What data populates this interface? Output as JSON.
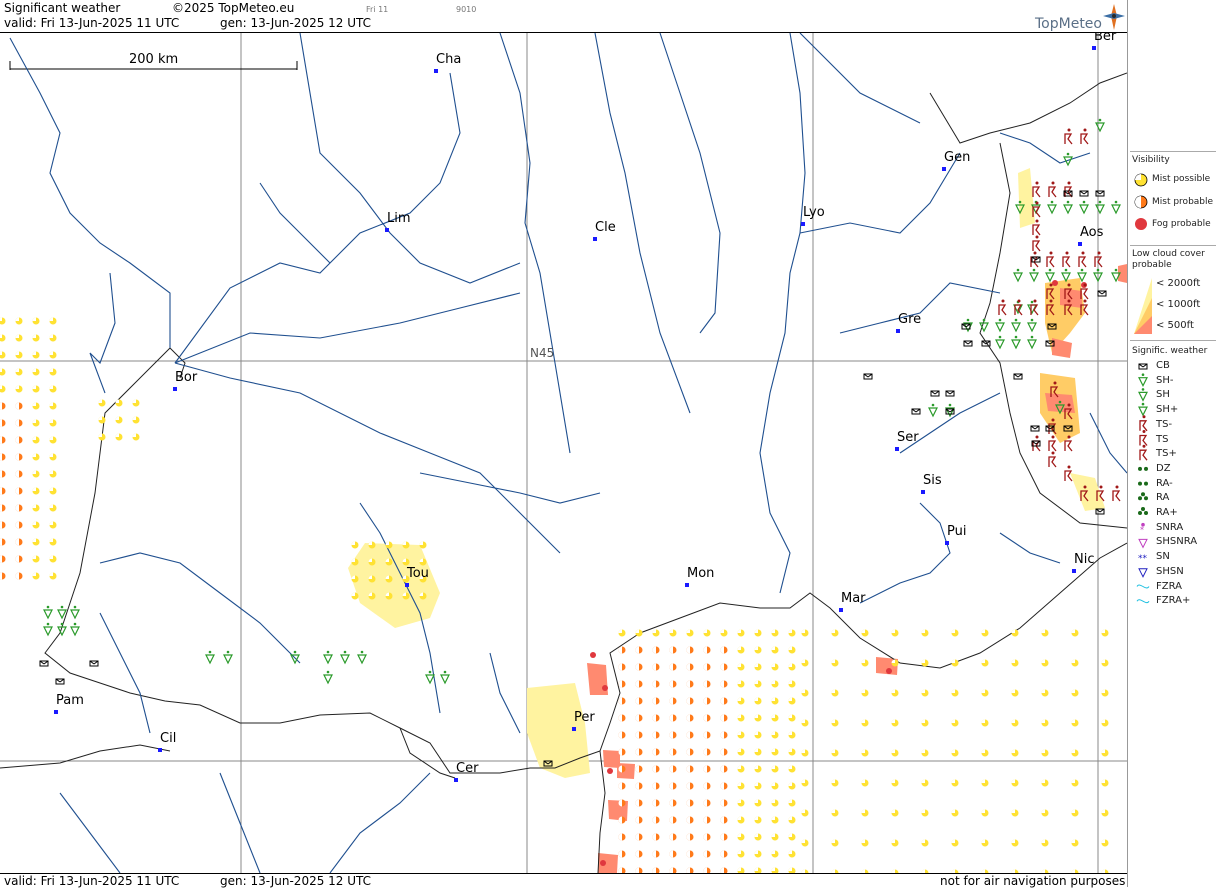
{
  "header": {
    "title": "Significant weather",
    "copyright": "©2025 TopMeteo.eu",
    "valid": "valid:  Fri  13-Jun-2025  11 UTC",
    "gen": "gen: 13-Jun-2025 12 UTC",
    "small1": "Fri 11",
    "small2": "9010",
    "logo": "TopMeteo"
  },
  "scale": {
    "label": "200 km"
  },
  "grid": {
    "label": "N45"
  },
  "cities": [
    {
      "name": "Cha",
      "key": "cha"
    },
    {
      "name": "Ber",
      "key": "ber"
    },
    {
      "name": "Gen",
      "key": "gen"
    },
    {
      "name": "Lim",
      "key": "lim"
    },
    {
      "name": "Cle",
      "key": "cle"
    },
    {
      "name": "Lyo",
      "key": "lyo"
    },
    {
      "name": "Aos",
      "key": "aos"
    },
    {
      "name": "Gre",
      "key": "gre"
    },
    {
      "name": "Bor",
      "key": "bor"
    },
    {
      "name": "Ser",
      "key": "ser"
    },
    {
      "name": "Sis",
      "key": "sis"
    },
    {
      "name": "Pui",
      "key": "pui"
    },
    {
      "name": "Tou",
      "key": "tou"
    },
    {
      "name": "Mon",
      "key": "mon"
    },
    {
      "name": "Mar",
      "key": "mar"
    },
    {
      "name": "Nic",
      "key": "nic"
    },
    {
      "name": "Pam",
      "key": "pam"
    },
    {
      "name": "Per",
      "key": "per"
    },
    {
      "name": "Cil",
      "key": "cil"
    },
    {
      "name": "Cer",
      "key": "cer"
    }
  ],
  "legend": {
    "visibility_title": "Visibility",
    "mist_possible": "Mist possible",
    "mist_probable": "Mist probable",
    "fog_probable": "Fog probable",
    "lowcloud_title": "Low cloud cover probable",
    "lc_2000": "< 2000ft",
    "lc_1000": "< 1000ft",
    "lc_500": "<   500ft",
    "signif_title": "Signific. weather",
    "items": [
      "CB",
      "SH-",
      "SH",
      "SH+",
      "TS-",
      "TS",
      "TS+",
      "DZ",
      "RA-",
      "RA",
      "RA+",
      "SNRA",
      "SHSNRA",
      "SN",
      "SHSN",
      "FZRA",
      "FZRA+"
    ],
    "colors": {
      "mist_possible": "#ffe233",
      "mist_probable": "#ff7a1a",
      "fog_probable": "#e0383e",
      "sh": "#2a9a2a",
      "ts": "#a01818",
      "dz": "#1a6a1a",
      "snra": "#c040c0",
      "sn": "#2020c0",
      "fzra": "#20c0e0",
      "lowcloud1": "#fff3a0",
      "lowcloud2": "#ffcc66",
      "lowcloud3": "#ff8a70"
    }
  },
  "footer": {
    "valid": "valid:  Fri  13-Jun-2025  11 UTC",
    "gen": "gen: 13-Jun-2025 12 UTC",
    "note": "not for air navigation purposes"
  }
}
